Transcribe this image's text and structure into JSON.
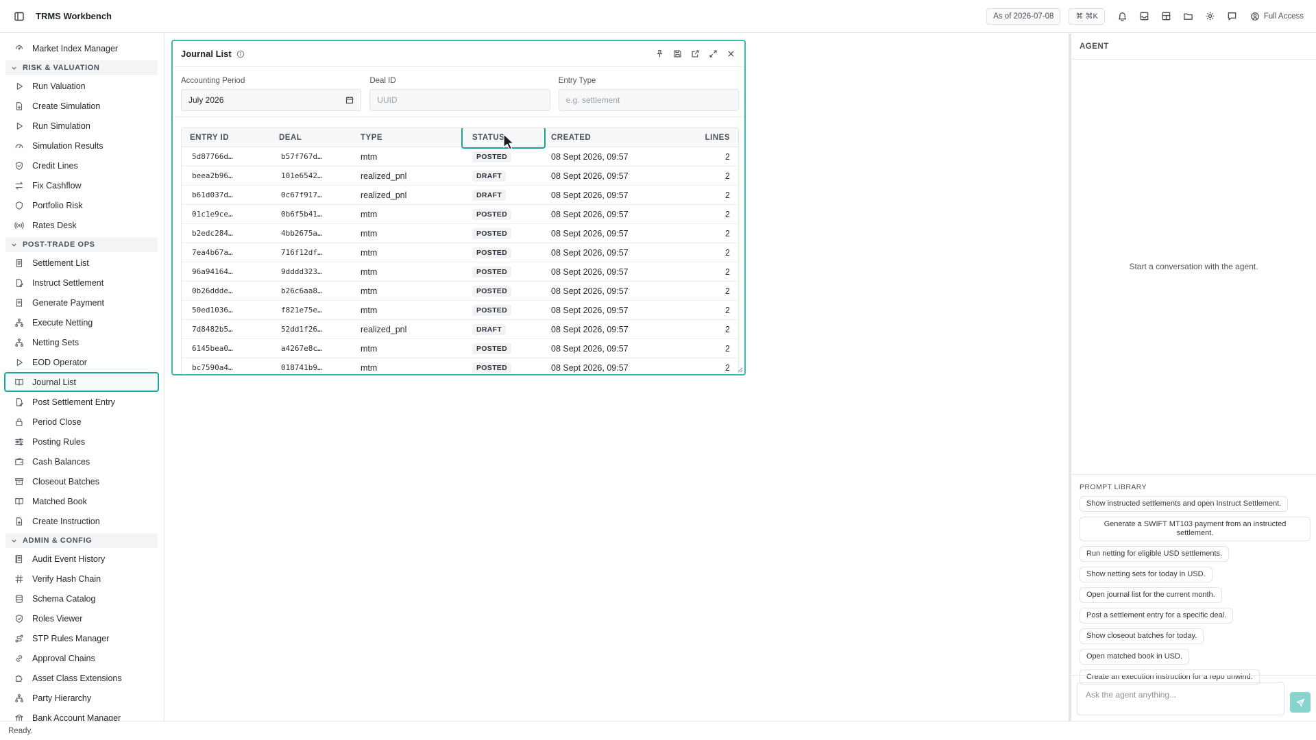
{
  "app": {
    "title": "TRMS Workbench"
  },
  "topbar": {
    "as_of": "As of 2026-07-08",
    "cmdk": "⌘ ⌘K",
    "access": "Full Access"
  },
  "sidebar": {
    "items": [
      {
        "type": "item",
        "label": "Market Index Manager",
        "icon": "index-icon",
        "top": 0
      },
      {
        "type": "section",
        "label": "RISK & VALUATION"
      },
      {
        "type": "item",
        "label": "Run Valuation",
        "icon": "play-icon"
      },
      {
        "type": "item",
        "label": "Create Simulation",
        "icon": "file-plus-icon"
      },
      {
        "type": "item",
        "label": "Run Simulation",
        "icon": "play-icon"
      },
      {
        "type": "item",
        "label": "Simulation Results",
        "icon": "gauge-icon"
      },
      {
        "type": "item",
        "label": "Credit Lines",
        "icon": "shield-check-icon"
      },
      {
        "type": "item",
        "label": "Fix Cashflow",
        "icon": "arrows-icon"
      },
      {
        "type": "item",
        "label": "Portfolio Risk",
        "icon": "shield-icon"
      },
      {
        "type": "item",
        "label": "Rates Desk",
        "icon": "radio-icon"
      },
      {
        "type": "section",
        "label": "POST-TRADE OPS"
      },
      {
        "type": "item",
        "label": "Settlement List",
        "icon": "list-doc-icon"
      },
      {
        "type": "item",
        "label": "Instruct Settlement",
        "icon": "file-edit-icon"
      },
      {
        "type": "item",
        "label": "Generate Payment",
        "icon": "receipt-icon"
      },
      {
        "type": "item",
        "label": "Execute Netting",
        "icon": "network-icon"
      },
      {
        "type": "item",
        "label": "Netting Sets",
        "icon": "network-icon"
      },
      {
        "type": "item",
        "label": "EOD Operator",
        "icon": "play-icon"
      },
      {
        "type": "item",
        "label": "Journal List",
        "icon": "book-icon",
        "active": true
      },
      {
        "type": "item",
        "label": "Post Settlement Entry",
        "icon": "file-edit-icon"
      },
      {
        "type": "item",
        "label": "Period Close",
        "icon": "lock-icon"
      },
      {
        "type": "item",
        "label": "Posting Rules",
        "icon": "sliders-icon"
      },
      {
        "type": "item",
        "label": "Cash Balances",
        "icon": "wallet-icon"
      },
      {
        "type": "item",
        "label": "Closeout Batches",
        "icon": "archive-icon"
      },
      {
        "type": "item",
        "label": "Matched Book",
        "icon": "book-icon"
      },
      {
        "type": "item",
        "label": "Create Instruction",
        "icon": "file-plus-icon"
      },
      {
        "type": "section",
        "label": "ADMIN & CONFIG"
      },
      {
        "type": "item",
        "label": "Audit Event History",
        "icon": "history-icon"
      },
      {
        "type": "item",
        "label": "Verify Hash Chain",
        "icon": "hash-icon"
      },
      {
        "type": "item",
        "label": "Schema Catalog",
        "icon": "database-icon"
      },
      {
        "type": "item",
        "label": "Roles Viewer",
        "icon": "shield-check-icon"
      },
      {
        "type": "item",
        "label": "STP Rules Manager",
        "icon": "route-icon"
      },
      {
        "type": "item",
        "label": "Approval Chains",
        "icon": "link-icon"
      },
      {
        "type": "item",
        "label": "Asset Class Extensions",
        "icon": "puzzle-icon"
      },
      {
        "type": "item",
        "label": "Party Hierarchy",
        "icon": "network-icon"
      },
      {
        "type": "item",
        "label": "Bank Account Manager",
        "icon": "bank-icon"
      }
    ]
  },
  "journal": {
    "title": "Journal List",
    "filters": {
      "period_label": "Accounting Period",
      "period_value": "July 2026",
      "deal_label": "Deal ID",
      "deal_placeholder": "UUID",
      "type_label": "Entry Type",
      "type_placeholder": "e.g. settlement"
    },
    "columns": [
      "ENTRY ID",
      "DEAL",
      "TYPE",
      "STATUS",
      "CREATED",
      "LINES"
    ],
    "rows": [
      {
        "id": "5d87766d…",
        "deal": "b57f767d…",
        "type": "mtm",
        "status": "POSTED",
        "created": "08 Sept 2026, 09:57",
        "lines": "2"
      },
      {
        "id": "beea2b96…",
        "deal": "101e6542…",
        "type": "realized_pnl",
        "status": "DRAFT",
        "created": "08 Sept 2026, 09:57",
        "lines": "2"
      },
      {
        "id": "b61d037d…",
        "deal": "0c67f917…",
        "type": "realized_pnl",
        "status": "DRAFT",
        "created": "08 Sept 2026, 09:57",
        "lines": "2"
      },
      {
        "id": "01c1e9ce…",
        "deal": "0b6f5b41…",
        "type": "mtm",
        "status": "POSTED",
        "created": "08 Sept 2026, 09:57",
        "lines": "2"
      },
      {
        "id": "b2edc284…",
        "deal": "4bb2675a…",
        "type": "mtm",
        "status": "POSTED",
        "created": "08 Sept 2026, 09:57",
        "lines": "2"
      },
      {
        "id": "7ea4b67a…",
        "deal": "716f12df…",
        "type": "mtm",
        "status": "POSTED",
        "created": "08 Sept 2026, 09:57",
        "lines": "2"
      },
      {
        "id": "96a94164…",
        "deal": "9dddd323…",
        "type": "mtm",
        "status": "POSTED",
        "created": "08 Sept 2026, 09:57",
        "lines": "2"
      },
      {
        "id": "0b26ddde…",
        "deal": "b26c6aa8…",
        "type": "mtm",
        "status": "POSTED",
        "created": "08 Sept 2026, 09:57",
        "lines": "2"
      },
      {
        "id": "50ed1036…",
        "deal": "f821e75e…",
        "type": "mtm",
        "status": "POSTED",
        "created": "08 Sept 2026, 09:57",
        "lines": "2"
      },
      {
        "id": "7d8482b5…",
        "deal": "52dd1f26…",
        "type": "realized_pnl",
        "status": "DRAFT",
        "created": "08 Sept 2026, 09:57",
        "lines": "2"
      },
      {
        "id": "6145bea0…",
        "deal": "a4267e8c…",
        "type": "mtm",
        "status": "POSTED",
        "created": "08 Sept 2026, 09:57",
        "lines": "2"
      },
      {
        "id": "bc7590a4…",
        "deal": "018741b9…",
        "type": "mtm",
        "status": "POSTED",
        "created": "08 Sept 2026, 09:57",
        "lines": "2"
      }
    ]
  },
  "agent": {
    "title": "AGENT",
    "empty": "Start a conversation with the agent.",
    "library_title": "PROMPT LIBRARY",
    "prompts": [
      "Show instructed settlements and open Instruct Settlement.",
      "Generate a SWIFT MT103 payment from an instructed settlement.",
      "Run netting for eligible USD settlements.",
      "Show netting sets for today in USD.",
      "Open journal list for the current month.",
      "Post a settlement entry for a specific deal.",
      "Show closeout batches for today.",
      "Open matched book in USD.",
      "Create an execution instruction for a repo unwind."
    ],
    "input_placeholder": "Ask the agent anything..."
  },
  "status": {
    "text": "Ready."
  },
  "colors": {
    "accent": "#1aa39a",
    "accent_light": "#86d4cb"
  }
}
